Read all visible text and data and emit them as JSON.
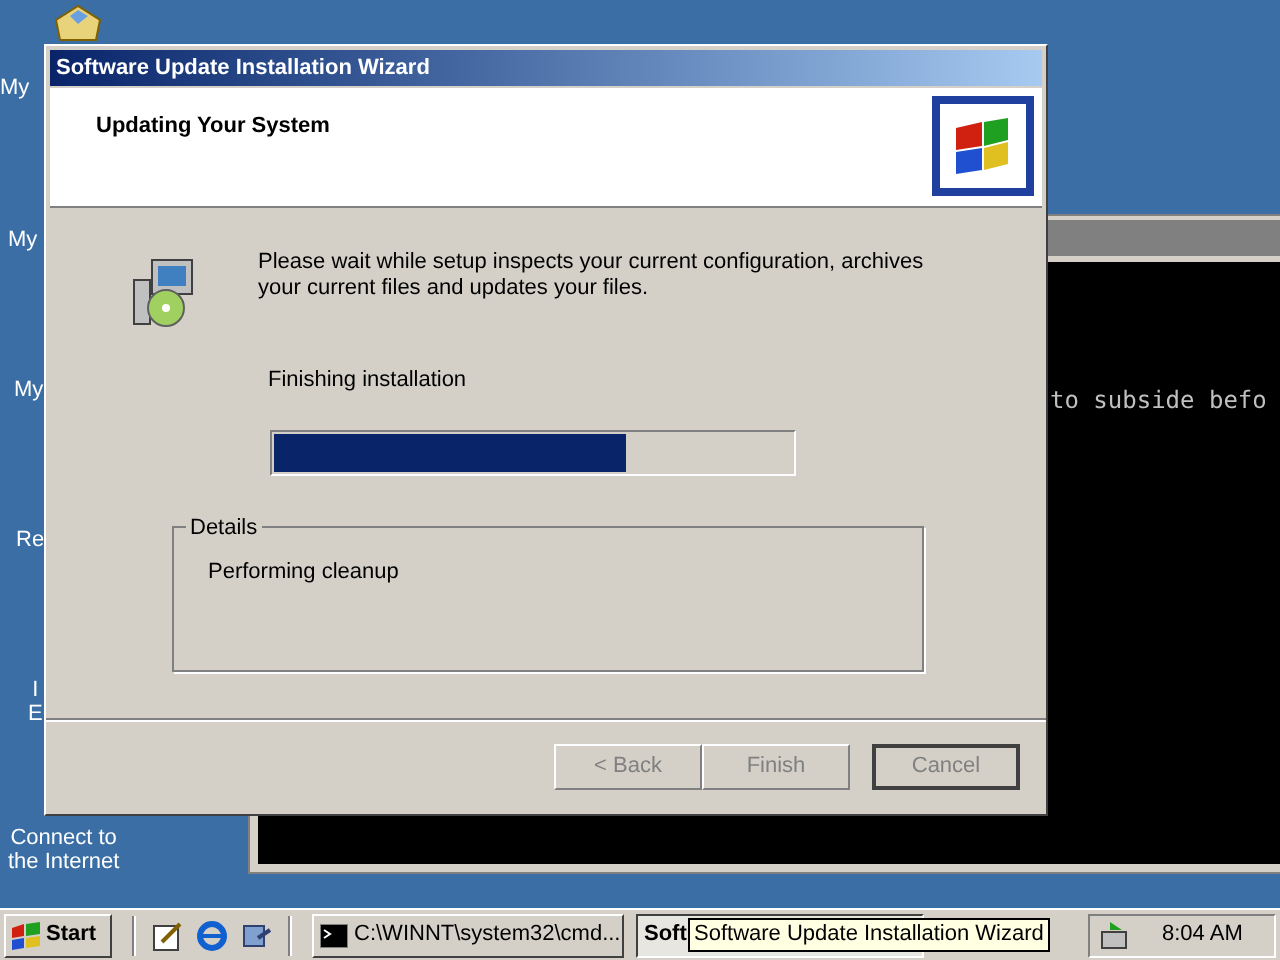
{
  "desktop_icons": [
    {
      "lines": [
        "My"
      ]
    },
    {
      "lines": [
        "My"
      ]
    },
    {
      "lines": [
        "My"
      ]
    },
    {
      "lines": [
        "Re"
      ]
    },
    {
      "lines": [
        "I",
        "E"
      ]
    },
    {
      "lines": [
        "Connect to",
        "the Internet"
      ]
    }
  ],
  "console_window": {
    "text": "to subside befo"
  },
  "dialog": {
    "title": "Software Update Installation Wizard",
    "heading": "Updating Your System",
    "message": "Please wait while setup inspects your current configuration, archives your current files and updates your files.",
    "step": "Finishing installation",
    "progress": {
      "level": 0.68
    },
    "details": {
      "legend": "Details",
      "text": "Performing cleanup"
    },
    "buttons": [
      {
        "label": "< Back",
        "disabled": true,
        "default": false
      },
      {
        "label": "Finish",
        "disabled": true,
        "default": false
      },
      {
        "label": "Cancel",
        "disabled": true,
        "default": true
      }
    ]
  },
  "taskbar": {
    "start": "Start",
    "tasks": [
      {
        "label": "C:\\WINNT\\system32\\cmd...",
        "kind": "console",
        "selected": false
      },
      {
        "label": "Soft",
        "kind": "plain",
        "selected": true
      }
    ],
    "tooltip": "Software Update Installation Wizard",
    "clock": "8:04 AM"
  }
}
